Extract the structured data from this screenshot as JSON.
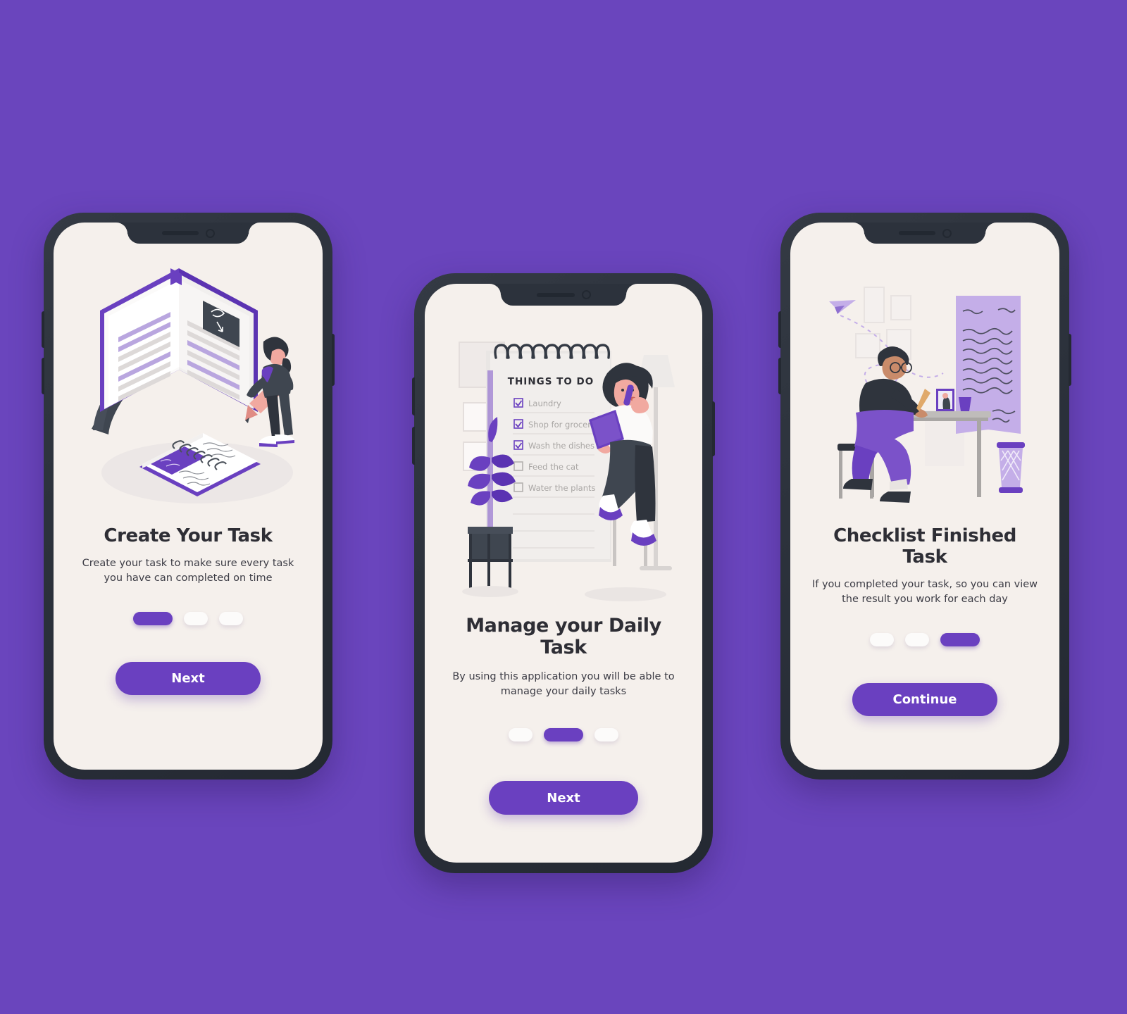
{
  "theme": {
    "background": "#6A45BD",
    "screen_background": "#F5F0EC",
    "accent": "#6A40C0",
    "frame": "#2c323c",
    "title_color": "#2e2e35",
    "dot_inactive": "#FCFBFA"
  },
  "screens": [
    {
      "id": "create-task",
      "title": "Create Your Task",
      "subtitle": "Create your task to make sure every task you have can completed on time",
      "cta_label": "Next",
      "dots": [
        "on",
        "off",
        "off"
      ],
      "illustration": "person-writing-in-notebook-isometric"
    },
    {
      "id": "manage-daily-task",
      "title": "Manage your Daily Task",
      "subtitle": "By using this application you will be able to manage your daily tasks",
      "cta_label": "Next",
      "dots": [
        "off",
        "on",
        "off"
      ],
      "illustration": "woman-with-todo-checklist",
      "checklist": {
        "heading": "THINGS TO DO",
        "items": [
          {
            "label": "Laundry",
            "checked": true
          },
          {
            "label": "Shop for groceries",
            "checked": true
          },
          {
            "label": "Wash the dishes",
            "checked": true
          },
          {
            "label": "Feed the cat",
            "checked": false
          },
          {
            "label": "Water the plants",
            "checked": false
          }
        ]
      }
    },
    {
      "id": "checklist-finished",
      "title": "Checklist Finished Task",
      "subtitle": "If you completed your task, so you can view the result you work for each day",
      "cta_label": "Continue",
      "dots": [
        "off",
        "off",
        "on"
      ],
      "illustration": "man-writing-letter-at-desk"
    }
  ]
}
